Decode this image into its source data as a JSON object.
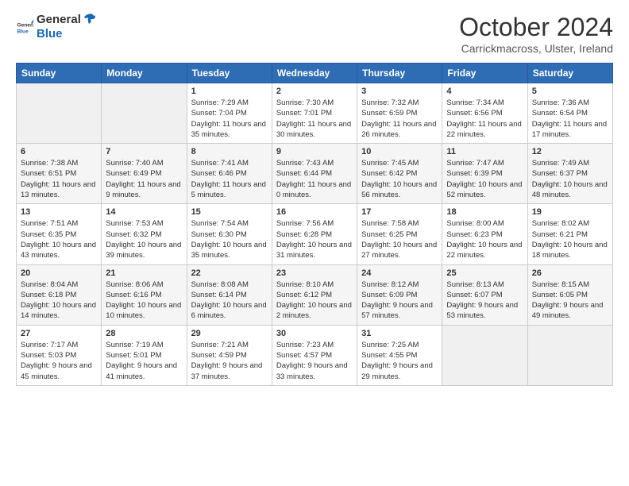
{
  "header": {
    "logo_general": "General",
    "logo_blue": "Blue",
    "title": "October 2024",
    "subtitle": "Carrickmacross, Ulster, Ireland"
  },
  "days_of_week": [
    "Sunday",
    "Monday",
    "Tuesday",
    "Wednesday",
    "Thursday",
    "Friday",
    "Saturday"
  ],
  "weeks": [
    [
      {
        "day": "",
        "sunrise": "",
        "sunset": "",
        "daylight": "",
        "empty": true
      },
      {
        "day": "",
        "sunrise": "",
        "sunset": "",
        "daylight": "",
        "empty": true
      },
      {
        "day": "1",
        "sunrise": "Sunrise: 7:29 AM",
        "sunset": "Sunset: 7:04 PM",
        "daylight": "Daylight: 11 hours and 35 minutes."
      },
      {
        "day": "2",
        "sunrise": "Sunrise: 7:30 AM",
        "sunset": "Sunset: 7:01 PM",
        "daylight": "Daylight: 11 hours and 30 minutes."
      },
      {
        "day": "3",
        "sunrise": "Sunrise: 7:32 AM",
        "sunset": "Sunset: 6:59 PM",
        "daylight": "Daylight: 11 hours and 26 minutes."
      },
      {
        "day": "4",
        "sunrise": "Sunrise: 7:34 AM",
        "sunset": "Sunset: 6:56 PM",
        "daylight": "Daylight: 11 hours and 22 minutes."
      },
      {
        "day": "5",
        "sunrise": "Sunrise: 7:36 AM",
        "sunset": "Sunset: 6:54 PM",
        "daylight": "Daylight: 11 hours and 17 minutes."
      }
    ],
    [
      {
        "day": "6",
        "sunrise": "Sunrise: 7:38 AM",
        "sunset": "Sunset: 6:51 PM",
        "daylight": "Daylight: 11 hours and 13 minutes."
      },
      {
        "day": "7",
        "sunrise": "Sunrise: 7:40 AM",
        "sunset": "Sunset: 6:49 PM",
        "daylight": "Daylight: 11 hours and 9 minutes."
      },
      {
        "day": "8",
        "sunrise": "Sunrise: 7:41 AM",
        "sunset": "Sunset: 6:46 PM",
        "daylight": "Daylight: 11 hours and 5 minutes."
      },
      {
        "day": "9",
        "sunrise": "Sunrise: 7:43 AM",
        "sunset": "Sunset: 6:44 PM",
        "daylight": "Daylight: 11 hours and 0 minutes."
      },
      {
        "day": "10",
        "sunrise": "Sunrise: 7:45 AM",
        "sunset": "Sunset: 6:42 PM",
        "daylight": "Daylight: 10 hours and 56 minutes."
      },
      {
        "day": "11",
        "sunrise": "Sunrise: 7:47 AM",
        "sunset": "Sunset: 6:39 PM",
        "daylight": "Daylight: 10 hours and 52 minutes."
      },
      {
        "day": "12",
        "sunrise": "Sunrise: 7:49 AM",
        "sunset": "Sunset: 6:37 PM",
        "daylight": "Daylight: 10 hours and 48 minutes."
      }
    ],
    [
      {
        "day": "13",
        "sunrise": "Sunrise: 7:51 AM",
        "sunset": "Sunset: 6:35 PM",
        "daylight": "Daylight: 10 hours and 43 minutes."
      },
      {
        "day": "14",
        "sunrise": "Sunrise: 7:53 AM",
        "sunset": "Sunset: 6:32 PM",
        "daylight": "Daylight: 10 hours and 39 minutes."
      },
      {
        "day": "15",
        "sunrise": "Sunrise: 7:54 AM",
        "sunset": "Sunset: 6:30 PM",
        "daylight": "Daylight: 10 hours and 35 minutes."
      },
      {
        "day": "16",
        "sunrise": "Sunrise: 7:56 AM",
        "sunset": "Sunset: 6:28 PM",
        "daylight": "Daylight: 10 hours and 31 minutes."
      },
      {
        "day": "17",
        "sunrise": "Sunrise: 7:58 AM",
        "sunset": "Sunset: 6:25 PM",
        "daylight": "Daylight: 10 hours and 27 minutes."
      },
      {
        "day": "18",
        "sunrise": "Sunrise: 8:00 AM",
        "sunset": "Sunset: 6:23 PM",
        "daylight": "Daylight: 10 hours and 22 minutes."
      },
      {
        "day": "19",
        "sunrise": "Sunrise: 8:02 AM",
        "sunset": "Sunset: 6:21 PM",
        "daylight": "Daylight: 10 hours and 18 minutes."
      }
    ],
    [
      {
        "day": "20",
        "sunrise": "Sunrise: 8:04 AM",
        "sunset": "Sunset: 6:18 PM",
        "daylight": "Daylight: 10 hours and 14 minutes."
      },
      {
        "day": "21",
        "sunrise": "Sunrise: 8:06 AM",
        "sunset": "Sunset: 6:16 PM",
        "daylight": "Daylight: 10 hours and 10 minutes."
      },
      {
        "day": "22",
        "sunrise": "Sunrise: 8:08 AM",
        "sunset": "Sunset: 6:14 PM",
        "daylight": "Daylight: 10 hours and 6 minutes."
      },
      {
        "day": "23",
        "sunrise": "Sunrise: 8:10 AM",
        "sunset": "Sunset: 6:12 PM",
        "daylight": "Daylight: 10 hours and 2 minutes."
      },
      {
        "day": "24",
        "sunrise": "Sunrise: 8:12 AM",
        "sunset": "Sunset: 6:09 PM",
        "daylight": "Daylight: 9 hours and 57 minutes."
      },
      {
        "day": "25",
        "sunrise": "Sunrise: 8:13 AM",
        "sunset": "Sunset: 6:07 PM",
        "daylight": "Daylight: 9 hours and 53 minutes."
      },
      {
        "day": "26",
        "sunrise": "Sunrise: 8:15 AM",
        "sunset": "Sunset: 6:05 PM",
        "daylight": "Daylight: 9 hours and 49 minutes."
      }
    ],
    [
      {
        "day": "27",
        "sunrise": "Sunrise: 7:17 AM",
        "sunset": "Sunset: 5:03 PM",
        "daylight": "Daylight: 9 hours and 45 minutes."
      },
      {
        "day": "28",
        "sunrise": "Sunrise: 7:19 AM",
        "sunset": "Sunset: 5:01 PM",
        "daylight": "Daylight: 9 hours and 41 minutes."
      },
      {
        "day": "29",
        "sunrise": "Sunrise: 7:21 AM",
        "sunset": "Sunset: 4:59 PM",
        "daylight": "Daylight: 9 hours and 37 minutes."
      },
      {
        "day": "30",
        "sunrise": "Sunrise: 7:23 AM",
        "sunset": "Sunset: 4:57 PM",
        "daylight": "Daylight: 9 hours and 33 minutes."
      },
      {
        "day": "31",
        "sunrise": "Sunrise: 7:25 AM",
        "sunset": "Sunset: 4:55 PM",
        "daylight": "Daylight: 9 hours and 29 minutes."
      },
      {
        "day": "",
        "sunrise": "",
        "sunset": "",
        "daylight": "",
        "empty": true
      },
      {
        "day": "",
        "sunrise": "",
        "sunset": "",
        "daylight": "",
        "empty": true
      }
    ]
  ]
}
